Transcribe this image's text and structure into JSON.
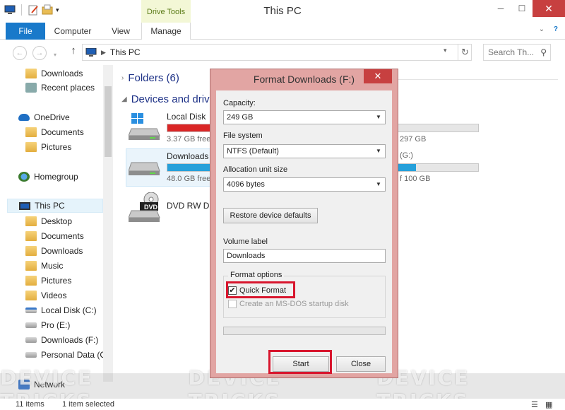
{
  "window": {
    "title": "This PC",
    "contextual_tab_group": "Drive Tools"
  },
  "ribbon": {
    "tabs": [
      {
        "label": "File"
      },
      {
        "label": "Computer"
      },
      {
        "label": "View"
      },
      {
        "label": "Manage"
      }
    ]
  },
  "address": {
    "path": "This PC",
    "search_placeholder": "Search Th..."
  },
  "nav": {
    "items": [
      {
        "label": "Downloads",
        "icon": "folder-icon"
      },
      {
        "label": "Recent places",
        "icon": "recent-places-icon"
      },
      {
        "label": "OneDrive",
        "icon": "onedrive-icon"
      },
      {
        "label": "Documents",
        "icon": "folder-icon"
      },
      {
        "label": "Pictures",
        "icon": "folder-icon"
      },
      {
        "label": "Homegroup",
        "icon": "homegroup-icon"
      },
      {
        "label": "This PC",
        "icon": "computer-icon"
      },
      {
        "label": "Desktop",
        "icon": "folder-icon"
      },
      {
        "label": "Documents",
        "icon": "folder-icon"
      },
      {
        "label": "Downloads",
        "icon": "folder-icon"
      },
      {
        "label": "Music",
        "icon": "folder-icon"
      },
      {
        "label": "Pictures",
        "icon": "folder-icon"
      },
      {
        "label": "Videos",
        "icon": "folder-icon"
      },
      {
        "label": "Local Disk (C:)",
        "icon": "system-drive-icon"
      },
      {
        "label": "Pro (E:)",
        "icon": "drive-icon"
      },
      {
        "label": "Downloads (F:)",
        "icon": "drive-icon"
      },
      {
        "label": "Personal Data (G",
        "icon": "drive-icon"
      },
      {
        "label": "Network",
        "icon": "network-icon"
      }
    ]
  },
  "content": {
    "folders_header": "Folders (6)",
    "devices_header": "Devices and drive",
    "drives": [
      {
        "name": "Local Disk",
        "free": "3.37 GB free",
        "right_text": "297 GB",
        "fill_fraction": 0.28,
        "bar_color": "#da2626"
      },
      {
        "name": "Downloads",
        "free": "48.0 GB free",
        "right_text": "(G:)",
        "right_text2": "f 100 GB",
        "fill_fraction": 0.8,
        "bar_color": "#26a0da"
      },
      {
        "name": "DVD RW Dri",
        "badge": "DVD"
      }
    ]
  },
  "dialog": {
    "title": "Format Downloads (F:)",
    "capacity_label": "Capacity:",
    "capacity_value": "249 GB",
    "filesystem_label": "File system",
    "filesystem_value": "NTFS (Default)",
    "alloc_label": "Allocation unit size",
    "alloc_value": "4096 bytes",
    "restore_button": "Restore device defaults",
    "volume_label": "Volume label",
    "volume_value": "Downloads",
    "format_options_label": "Format options",
    "quick_format_label": "Quick Format",
    "quick_format_checked": true,
    "msdos_label": "Create an MS-DOS startup disk",
    "start_button": "Start",
    "close_button": "Close"
  },
  "status": {
    "item_count": "11 items",
    "selection": "1 item selected"
  },
  "watermark": {
    "text": "DEVICE TRICKS"
  }
}
